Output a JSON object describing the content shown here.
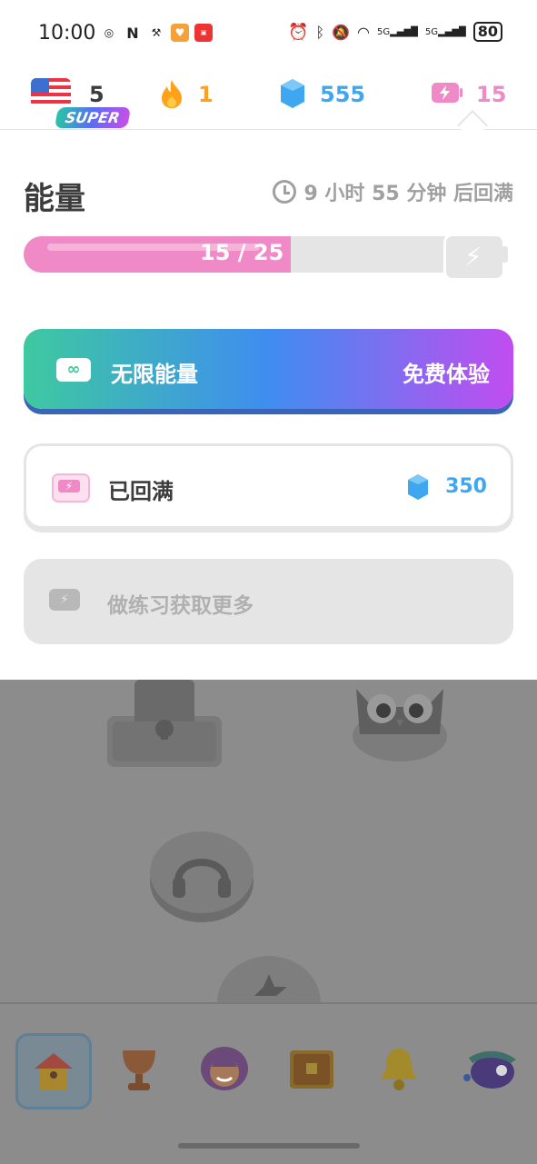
{
  "status_bar": {
    "time": "10:00",
    "left_icons": [
      "app-icon",
      "nfc-icon",
      "broom-icon",
      "heart-app-icon",
      "xiaohongshu-icon"
    ],
    "right_icons": [
      "alarm-icon",
      "bluetooth-icon",
      "mute-icon",
      "wifi-icon",
      "signal-5g-icon",
      "signal-5g-icon"
    ],
    "signal_labels": [
      "5G",
      "5G"
    ],
    "battery": "80"
  },
  "top_bar": {
    "language_count": "5",
    "super_badge": "SUPER",
    "streak": "1",
    "gems": "555",
    "energy": "15",
    "colors": {
      "streak": "#ffa21a",
      "gems": "#3ea7ef",
      "energy": "#f08ac6"
    }
  },
  "energy_panel": {
    "title": "能量",
    "refill_timer": "9 小时 55 分钟 后回满",
    "progress_text": "15 / 25",
    "progress_value": 15,
    "progress_max": 25,
    "unlimited": {
      "label": "无限能量",
      "action": "免费体验"
    },
    "refill": {
      "label": "已回满",
      "price": "350"
    },
    "practice": {
      "label": "做练习获取更多"
    }
  },
  "nav": {
    "items": [
      "home-icon",
      "trophy-icon",
      "profile-icon",
      "chest-icon",
      "bell-icon",
      "more-icon"
    ]
  }
}
